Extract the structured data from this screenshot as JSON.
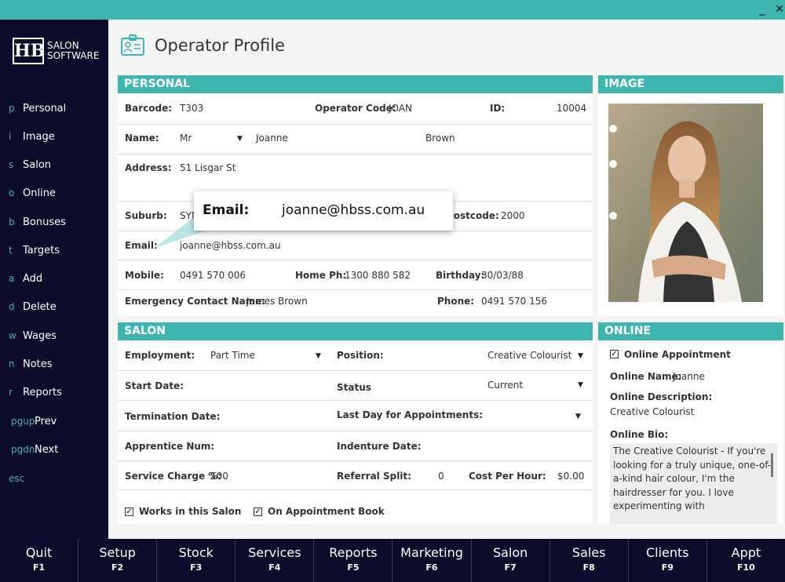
{
  "window": {
    "minimize_label": "_",
    "close_label": "✕"
  },
  "logo": {
    "mark": "HB",
    "line1": "SALON",
    "line2": "SOFTWARE"
  },
  "sidebar": {
    "items": [
      {
        "key": "p",
        "label": "Personal"
      },
      {
        "key": "i",
        "label": "Image"
      },
      {
        "key": "s",
        "label": "Salon"
      },
      {
        "key": "o",
        "label": "Online"
      },
      {
        "key": "b",
        "label": "Bonuses"
      },
      {
        "key": "t",
        "label": "Targets"
      },
      {
        "key": "a",
        "label": "Add"
      },
      {
        "key": "d",
        "label": "Delete"
      },
      {
        "key": "w",
        "label": "Wages"
      },
      {
        "key": "n",
        "label": "Notes"
      },
      {
        "key": "r",
        "label": "Reports"
      },
      {
        "key": "pgup",
        "label": "Prev"
      },
      {
        "key": "pgdn",
        "label": "Next"
      },
      {
        "key": "esc",
        "label": ""
      }
    ]
  },
  "page_title": "Operator Profile",
  "personal": {
    "header": "PERSONAL",
    "barcode_label": "Barcode:",
    "barcode": "T303",
    "opcode_label": "Operator Code:",
    "opcode": "JOAN",
    "id_label": "ID:",
    "id": "10004",
    "name_label": "Name:",
    "title": "Mr",
    "first_name": "Joanne",
    "last_name": "Brown",
    "address_label": "Address:",
    "address": "51 Lisgar St",
    "suburb_label": "Suburb:",
    "suburb": "SYD",
    "postcode_label": "Postcode:",
    "postcode": "2000",
    "email_label": "Email:",
    "email": "joanne@hbss.com.au",
    "mobile_label": "Mobile:",
    "mobile": "0491 570 006",
    "homeph_label": "Home Ph:",
    "homeph": "1300 880 582",
    "birthday_label": "Birthday:",
    "birthday": "30/03/88",
    "emergency_label": "Emergency Contact Name:",
    "emergency": "James Brown",
    "phone_label": "Phone:",
    "phone": "0491 570 156"
  },
  "callout": {
    "label": "Email:",
    "value": "joanne@hbss.com.au"
  },
  "image": {
    "header": "IMAGE"
  },
  "salon": {
    "header": "SALON",
    "employment_label": "Employment:",
    "employment": "Part Time",
    "position_label": "Position:",
    "position": "Creative Colourist",
    "start_label": "Start Date:",
    "status_label": "Status",
    "status": "Current",
    "termination_label": "Termination Date:",
    "lastday_label": "Last Day for Appointments:",
    "apprentice_label": "Apprentice Num:",
    "indenture_label": "Indenture Date:",
    "service_label": "Service Charge %:",
    "service": "100",
    "referral_label": "Referral Split:",
    "referral": "0",
    "cost_label": "Cost Per Hour:",
    "cost": "$0.00",
    "works_label": "Works in this Salon",
    "onbook_label": "On Appointment Book"
  },
  "online": {
    "header": "ONLINE",
    "appt_label": "Online Appointment",
    "name_label": "Online Name:",
    "name": "Joanne",
    "desc_label": "Online Description:",
    "desc": "Creative Colourist",
    "bio_label": "Online Bio:",
    "bio": "The Creative Colourist - If you're looking for a truly unique, one-of-a-kind hair colour, I'm the hairdresser for you. I love experimenting with"
  },
  "fkeys": [
    {
      "label": "Quit",
      "code": "F1"
    },
    {
      "label": "Setup",
      "code": "F2"
    },
    {
      "label": "Stock",
      "code": "F3"
    },
    {
      "label": "Services",
      "code": "F4"
    },
    {
      "label": "Reports",
      "code": "F5"
    },
    {
      "label": "Marketing",
      "code": "F6"
    },
    {
      "label": "Salon",
      "code": "F7"
    },
    {
      "label": "Sales",
      "code": "F8"
    },
    {
      "label": "Clients",
      "code": "F9"
    },
    {
      "label": "Appt",
      "code": "F10"
    }
  ],
  "colors": {
    "accent": "#3fb5b0",
    "sidebar": "#0c0c2a"
  }
}
